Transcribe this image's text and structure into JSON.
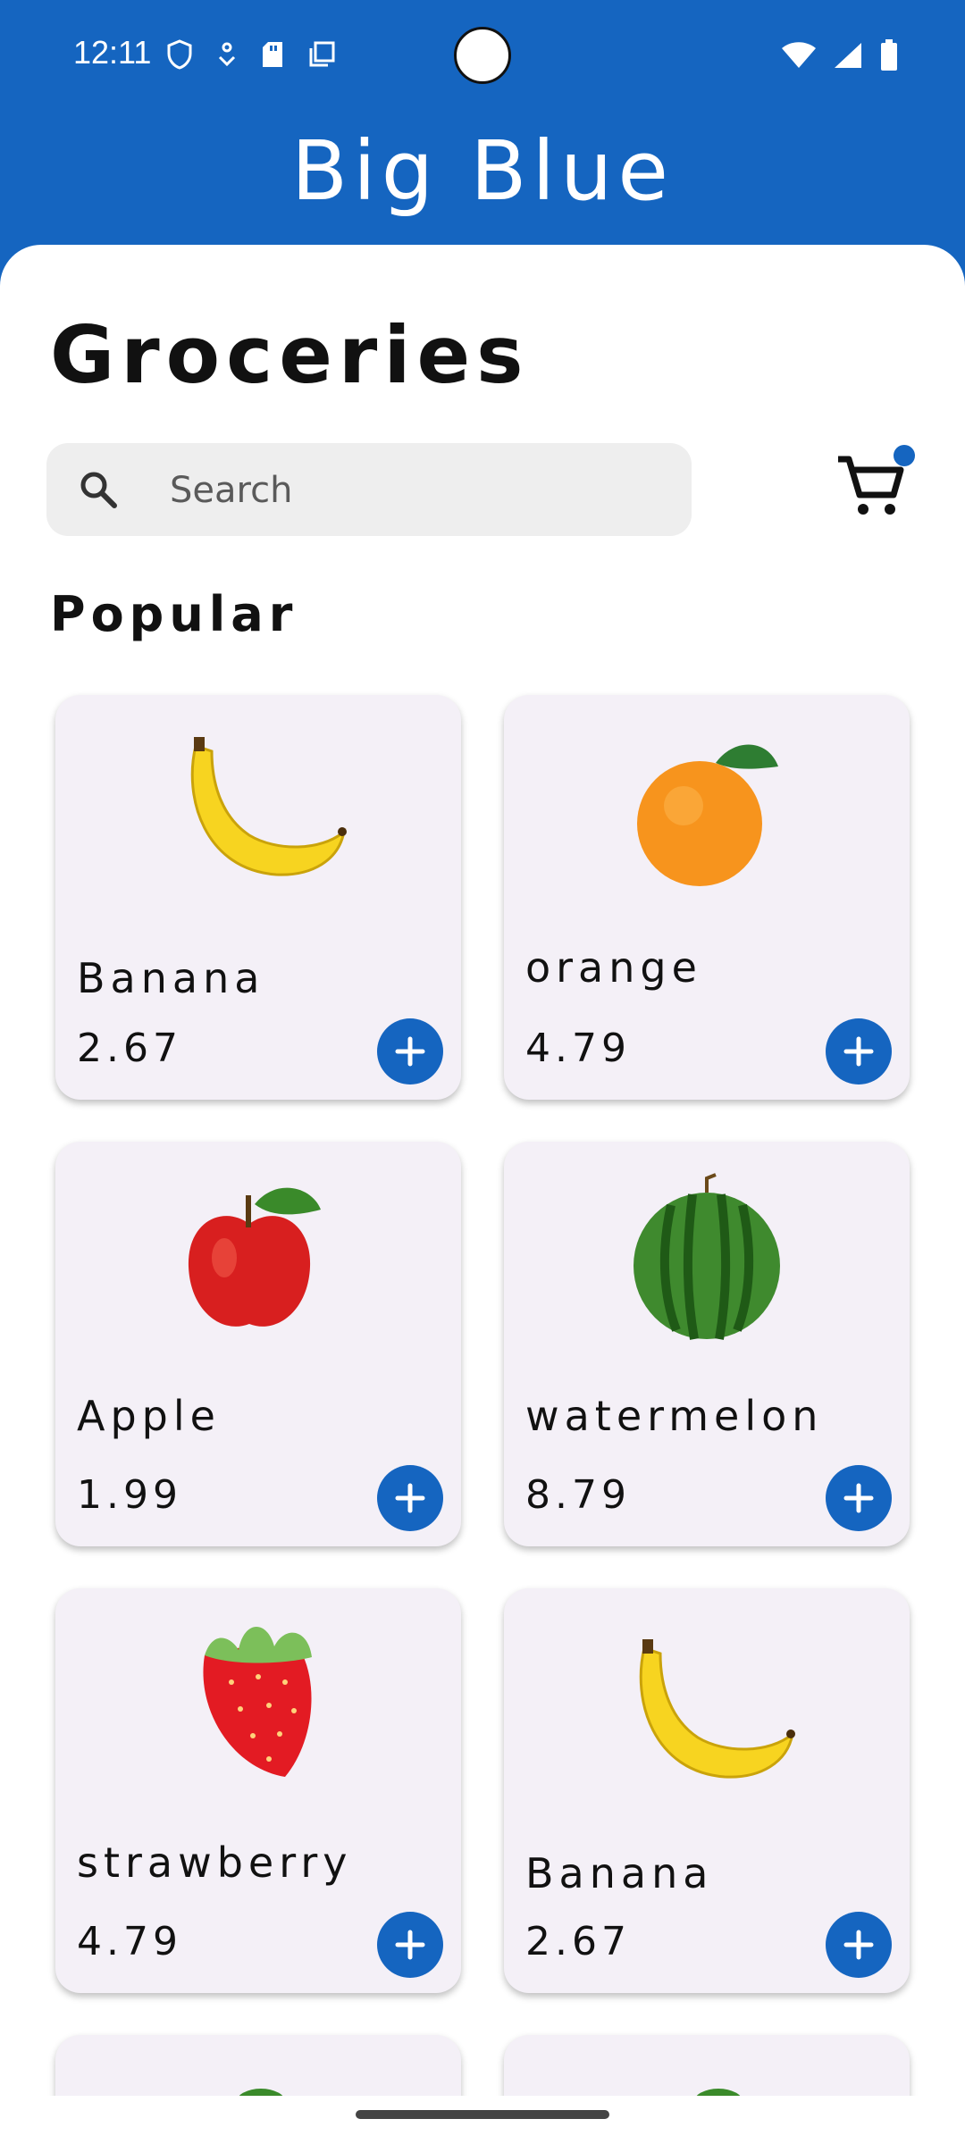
{
  "status_bar": {
    "time": "12:11"
  },
  "header": {
    "brand": "Big Blue"
  },
  "main": {
    "title": "Groceries",
    "search": {
      "placeholder": "Search"
    },
    "section_title": "Popular",
    "accent_color": "#1565c0",
    "products": [
      {
        "name": "Banana",
        "price": "2.67",
        "icon": "banana"
      },
      {
        "name": "orange",
        "price": "4.79",
        "icon": "orange"
      },
      {
        "name": "Apple",
        "price": "1.99",
        "icon": "apple"
      },
      {
        "name": "watermelon",
        "price": "8.79",
        "icon": "watermelon"
      },
      {
        "name": "strawberry",
        "price": "4.79",
        "icon": "strawberry"
      },
      {
        "name": "Banana",
        "price": "2.67",
        "icon": "banana"
      }
    ]
  }
}
